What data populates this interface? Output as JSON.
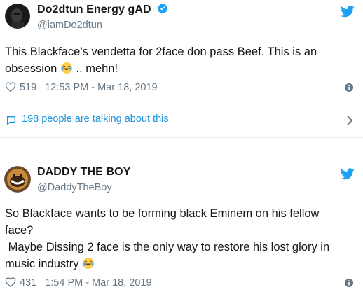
{
  "tweets": [
    {
      "author_name": "Do2dtun Energy gAD",
      "handle": "@iamDo2dtun",
      "verified": true,
      "text_line1": "This Blackface’s vendetta for 2face don pass Beef. This is an",
      "text_line2_prefix": "obsession",
      "text_line2_suffix": ".. mehn!",
      "likes": "519",
      "timestamp": "12:53 PM - Mar 18, 2019",
      "conversation_label": "198 people are talking about this"
    },
    {
      "author_name": "DADDY THE BOY",
      "handle": "@DaddyTheBoy",
      "verified": false,
      "text_line1": "So Blackface wants to be forming black Eminem on his fellow",
      "text_line2": "face?",
      "text_line3": " Maybe Dissing 2 face is the only way to restore his lost glory in",
      "text_line4_prefix": "music industry",
      "likes": "431",
      "timestamp": "1:54 PM - Mar 18, 2019"
    }
  ],
  "colors": {
    "twitter_blue": "#1da1f2",
    "link_blue": "#1b95e0",
    "secondary_gray": "#657786",
    "divider": "#e6ecf0"
  },
  "icons": [
    "twitter-bird-icon",
    "verified-badge-icon",
    "heart-icon",
    "info-icon",
    "comment-bubble-icon",
    "chevron-right-icon",
    "laughing-emoji-icon"
  ]
}
